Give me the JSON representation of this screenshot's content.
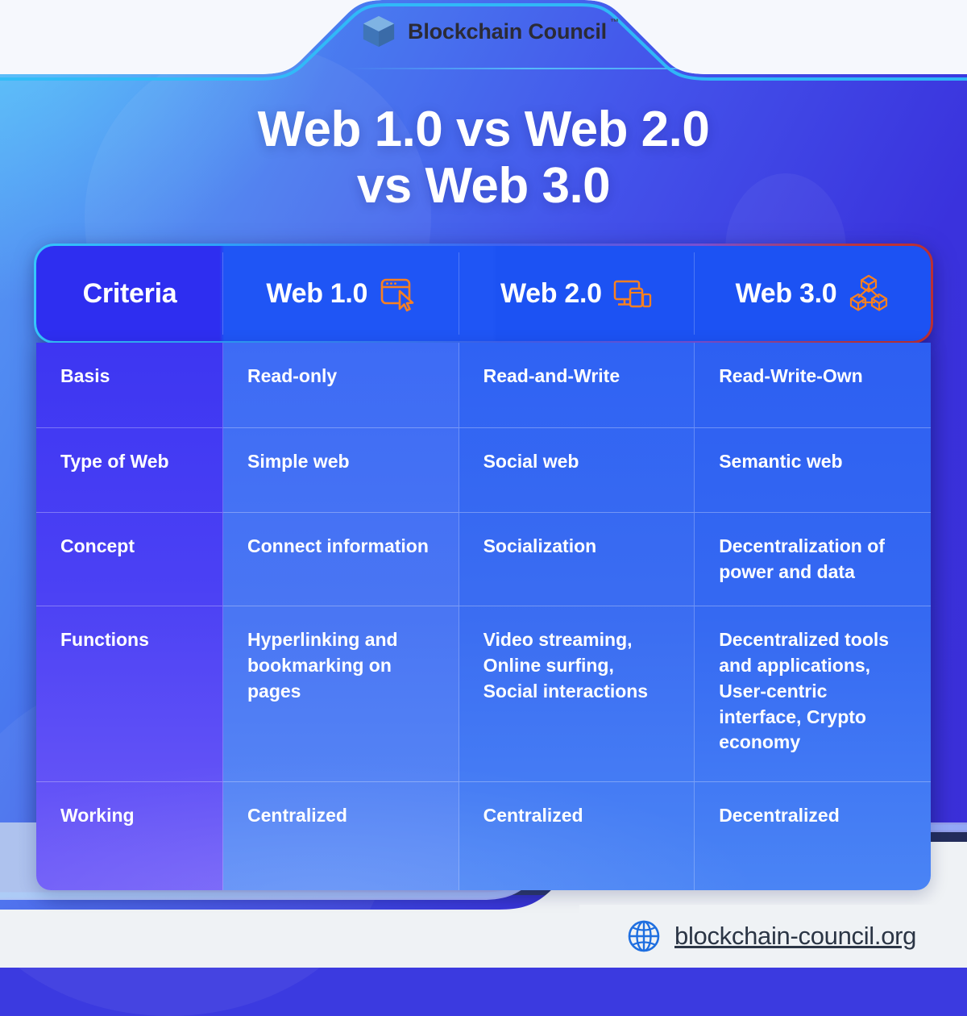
{
  "brand": {
    "logo_text": "Blockchain Council",
    "trademark": "™",
    "logo_icon": "cube-icon"
  },
  "title": {
    "line1": "Web 1.0 vs Web 2.0",
    "line2": "vs Web 3.0"
  },
  "table": {
    "headers": [
      {
        "label": "Criteria",
        "icon": null
      },
      {
        "label": "Web 1.0",
        "icon": "browser-window-cursor-icon"
      },
      {
        "label": "Web 2.0",
        "icon": "devices-monitor-phone-icon"
      },
      {
        "label": "Web 3.0",
        "icon": "blockchain-cubes-icon"
      }
    ],
    "rows": [
      {
        "criteria": "Basis",
        "web1": "Read-only",
        "web2": "Read-and-Write",
        "web3": "Read-Write-Own"
      },
      {
        "criteria": "Type of Web",
        "web1": "Simple web",
        "web2": "Social web",
        "web3": "Semantic web"
      },
      {
        "criteria": "Concept",
        "web1": "Connect information",
        "web2": "Socialization",
        "web3": "Decentralization of power and data"
      },
      {
        "criteria": "Functions",
        "web1": "Hyperlinking and bookmarking on pages",
        "web2": "Video streaming, Online surfing, Social interactions",
        "web3": "Decentralized tools and applications, User-centric interface, Crypto economy"
      },
      {
        "criteria": "Working",
        "web1": "Centralized",
        "web2": "Centralized",
        "web3": "Decentralized"
      }
    ]
  },
  "footer": {
    "url": "blockchain-council.org",
    "icon": "globe-icon"
  },
  "colors": {
    "accent_orange": "#f98020",
    "brand_blue": "#1f6fe0",
    "header_cyan_edge": "#35c6fb",
    "header_red_edge": "#c03434",
    "bg_blue": "#4352ea",
    "footer_bg": "#eff2f5"
  }
}
